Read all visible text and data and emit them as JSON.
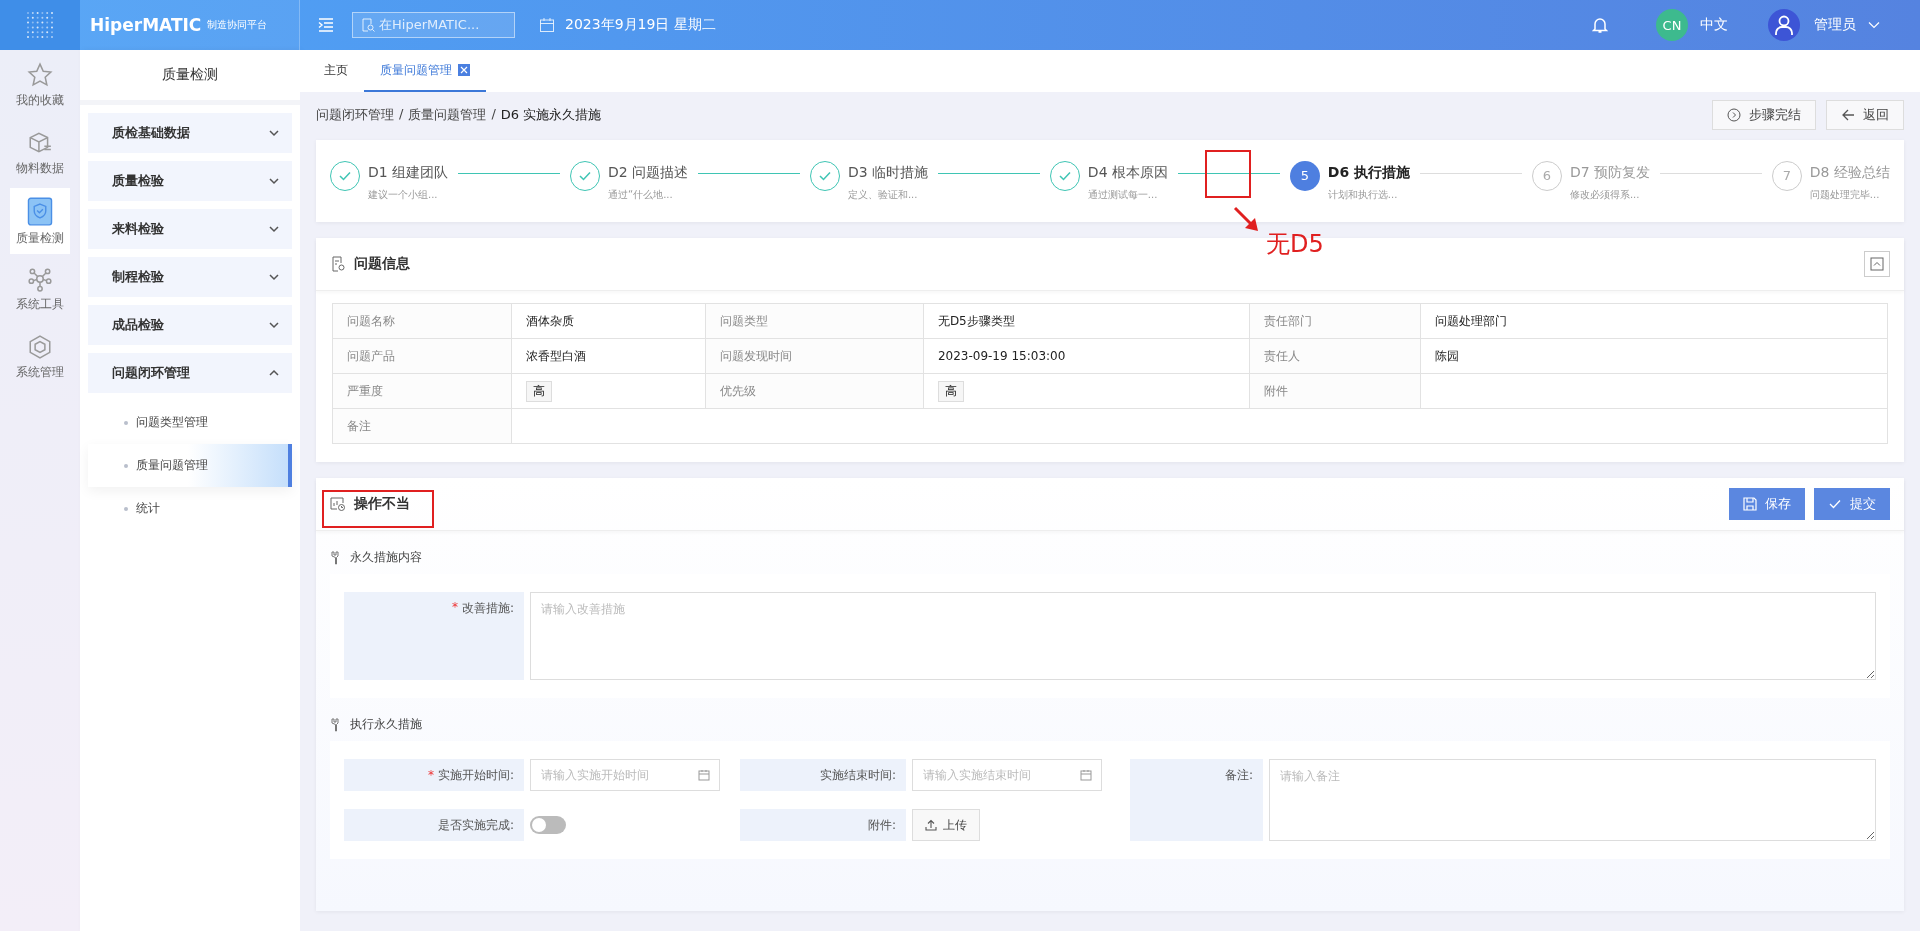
{
  "header": {
    "logo": "HiperMATIC",
    "logo_subtitle": "制造协同平台",
    "search_placeholder": "在HiperMATIC...",
    "date": "2023年9月19日 星期二",
    "language_badge": "CN",
    "language": "中文",
    "user": "管理员"
  },
  "rail": [
    {
      "kind": "star",
      "label": "我的收藏",
      "selected": false
    },
    {
      "kind": "box",
      "label": "物料数据",
      "selected": false
    },
    {
      "kind": "shield",
      "label": "质量检测",
      "selected": true
    },
    {
      "kind": "network",
      "label": "系统工具",
      "selected": false
    },
    {
      "kind": "cube",
      "label": "系统管理",
      "selected": false
    }
  ],
  "sidebar": {
    "title": "质量检测",
    "groups": [
      {
        "label": "质检基础数据",
        "expanded": false
      },
      {
        "label": "质量检验",
        "expanded": false
      },
      {
        "label": "来料检验",
        "expanded": false
      },
      {
        "label": "制程检验",
        "expanded": false
      },
      {
        "label": "成品检验",
        "expanded": false
      },
      {
        "label": "问题闭环管理",
        "expanded": true,
        "children": [
          {
            "label": "问题类型管理",
            "selected": false
          },
          {
            "label": "质量问题管理",
            "selected": true
          },
          {
            "label": "统计",
            "selected": false
          }
        ]
      }
    ]
  },
  "tabs": [
    {
      "label": "主页",
      "selected": false,
      "closable": false
    },
    {
      "label": "质量问题管理",
      "selected": true,
      "closable": true
    }
  ],
  "breadcrumb": [
    {
      "kind": "link",
      "label": "问题闭环管理"
    },
    {
      "kind": "separator",
      "label": "/"
    },
    {
      "kind": "link",
      "label": "质量问题管理"
    },
    {
      "kind": "separator",
      "label": "/"
    },
    {
      "kind": "current",
      "label": "D6 实施永久措施"
    }
  ],
  "page_actions": [
    {
      "kind": "done",
      "label": "步骤完结"
    },
    {
      "kind": "back",
      "label": "返回"
    }
  ],
  "steps": [
    {
      "kind": "done",
      "title": "D1 组建团队",
      "description": "建议一个小组..."
    },
    {
      "kind": "done",
      "title": "D2 问题描述",
      "description": "通过“什么地..."
    },
    {
      "kind": "done",
      "title": "D3 临时措施",
      "description": "定义、验证和..."
    },
    {
      "kind": "done",
      "title": "D4 根本原因",
      "description": "通过测试每一..."
    },
    {
      "kind": "current",
      "number": "5",
      "title": "D6 执行措施",
      "description": "计划和执行选..."
    },
    {
      "kind": "pending",
      "number": "6",
      "title": "D7 预防复发",
      "description": "修改必须得系..."
    },
    {
      "kind": "pending",
      "number": "7",
      "title": "D8 经验总结",
      "description": "问题处理完毕..."
    }
  ],
  "annotation": {
    "label": "无D5"
  },
  "issue_info": {
    "title": "问题信息",
    "rows": [
      [
        {
          "label": "问题名称",
          "value": "酒体杂质"
        },
        {
          "label": "问题类型",
          "value": "无D5步骤类型"
        },
        {
          "label": "责任部门",
          "value": "问题处理部门"
        }
      ],
      [
        {
          "label": "问题产品",
          "value": "浓香型白酒"
        },
        {
          "label": "问题发现时间",
          "value": "2023-09-19 15:03:00"
        },
        {
          "label": "责任人",
          "value": "陈园"
        }
      ],
      [
        {
          "label": "严重度",
          "value": "高",
          "kind": "tag"
        },
        {
          "label": "优先级",
          "value": "高",
          "kind": "tag"
        },
        {
          "label": "附件"
        }
      ],
      [
        {
          "label": "备注"
        }
      ]
    ]
  },
  "action_card": {
    "title": "操作不当",
    "buttons": [
      {
        "kind": "save",
        "label": "保存"
      },
      {
        "kind": "submit",
        "label": "提交"
      }
    ],
    "content_section": {
      "title": "永久措施内容",
      "field": {
        "required_mark": "*",
        "label": "改善措施:",
        "placeholder": "请输入改善措施"
      }
    },
    "execute_section": {
      "title": "执行永久措施",
      "start": {
        "required_mark": "*",
        "label": "实施开始时间:",
        "placeholder": "请输入实施开始时间"
      },
      "end": {
        "label": "实施结束时间:",
        "placeholder": "请输入实施结束时间"
      },
      "remark": {
        "label": "备注:",
        "placeholder": "请输入备注"
      },
      "completed": {
        "label": "是否实施完成:",
        "on": false
      },
      "attachment": {
        "label": "附件:",
        "button": "上传"
      }
    }
  }
}
